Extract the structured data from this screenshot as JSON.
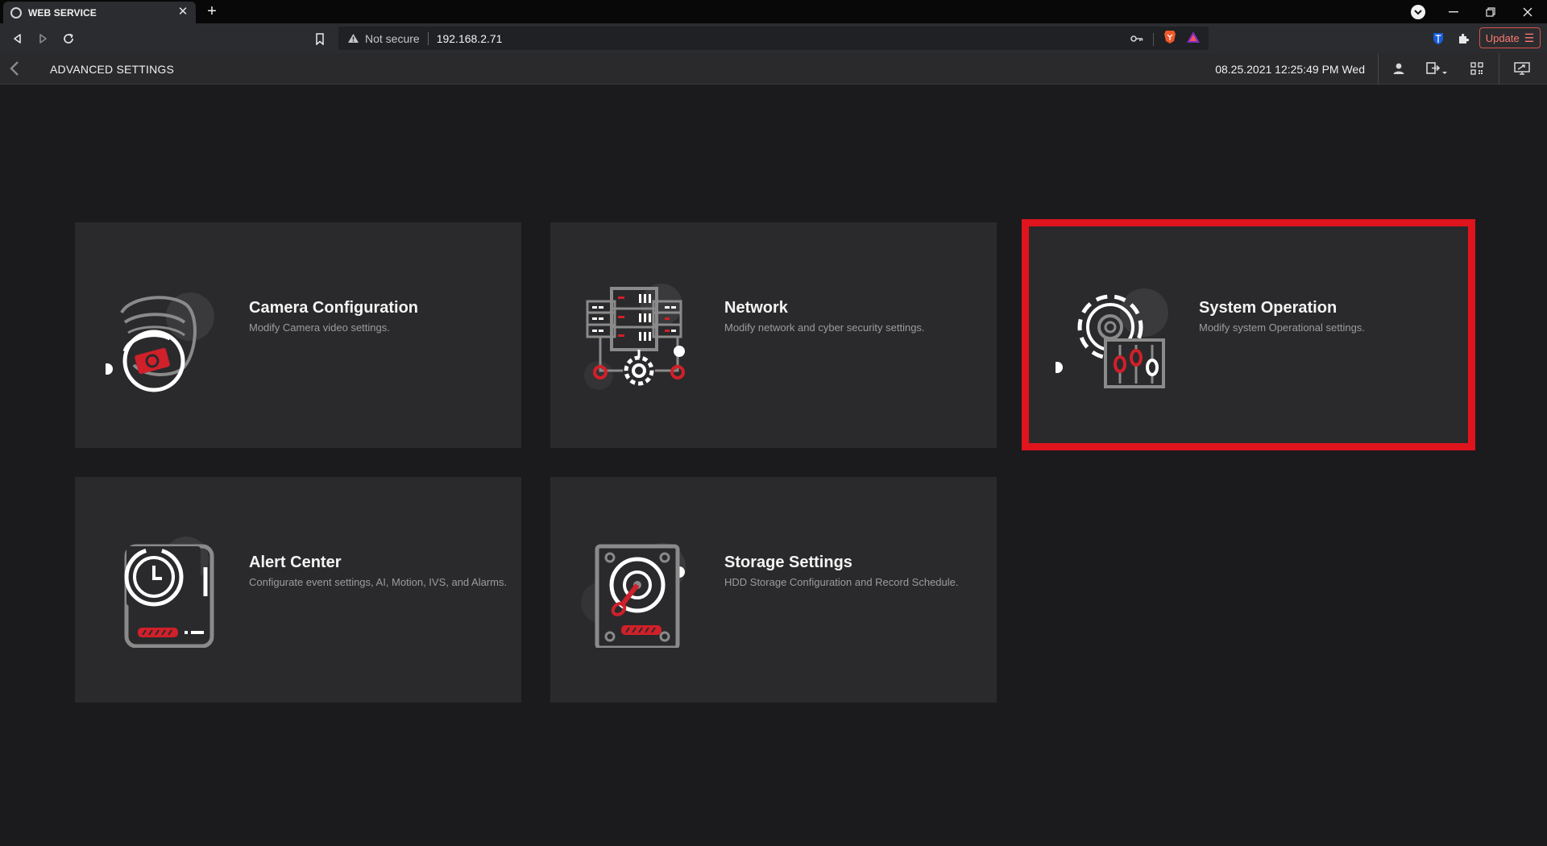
{
  "browser": {
    "tab_title": "WEB SERVICE",
    "security_label": "Not secure",
    "url": "192.168.2.71",
    "update_label": "Update"
  },
  "app": {
    "title": "ADVANCED SETTINGS",
    "datetime": "08.25.2021 12:25:49 PM Wed"
  },
  "cards": [
    {
      "title": "Camera Configuration",
      "description": "Modify Camera video settings.",
      "icon": "dome-camera-icon"
    },
    {
      "title": "Network",
      "description": "Modify network and cyber security settings.",
      "icon": "network-server-icon"
    },
    {
      "title": "System Operation",
      "description": "Modify system Operational settings.",
      "icon": "gear-sliders-icon",
      "highlighted": true
    },
    {
      "title": "Alert Center",
      "description": "Configurate event settings, AI, Motion, IVS, and Alarms.",
      "icon": "alarm-clock-device-icon"
    },
    {
      "title": "Storage Settings",
      "description": "HDD Storage Configuration and Record Schedule.",
      "icon": "hard-drive-icon"
    }
  ],
  "colors": {
    "accent_red": "#e0141c",
    "icon_red": "#d0202a",
    "icon_gray": "#8a8a8a",
    "card_bg": "#2a2a2c",
    "page_bg": "#1b1b1d"
  }
}
